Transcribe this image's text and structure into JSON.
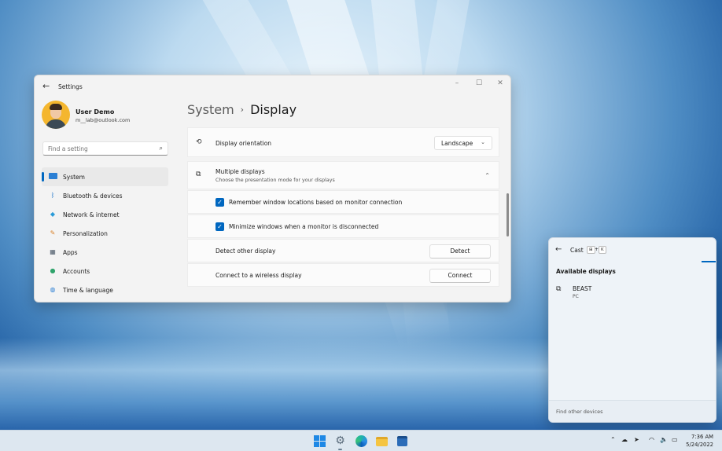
{
  "settings_window": {
    "title": "Settings",
    "profile": {
      "name": "User Demo",
      "email": "m__lab@outlook.com"
    },
    "search": {
      "placeholder": "Find a setting"
    },
    "nav_items": [
      {
        "label": "System",
        "icon": "system-icon",
        "active": true
      },
      {
        "label": "Bluetooth & devices",
        "icon": "bluetooth-icon"
      },
      {
        "label": "Network & internet",
        "icon": "wifi-icon"
      },
      {
        "label": "Personalization",
        "icon": "brush-icon"
      },
      {
        "label": "Apps",
        "icon": "apps-icon"
      },
      {
        "label": "Accounts",
        "icon": "accounts-icon"
      },
      {
        "label": "Time & language",
        "icon": "globe-icon"
      }
    ],
    "breadcrumb": {
      "parent": "System",
      "separator": "›",
      "current": "Display"
    },
    "display_orientation": {
      "label": "Display orientation",
      "value": "Landscape"
    },
    "multiple_displays": {
      "title": "Multiple displays",
      "subtitle": "Choose the presentation mode for your displays",
      "options": [
        {
          "label": "Remember window locations based on monitor connection",
          "checked": true
        },
        {
          "label": "Minimize windows when a monitor is disconnected",
          "checked": true
        }
      ],
      "detect": {
        "label": "Detect other display",
        "button": "Detect"
      },
      "wireless": {
        "label": "Connect to a wireless display",
        "button": "Connect"
      }
    }
  },
  "cast_panel": {
    "title": "Cast",
    "shortcut_keys": [
      "⊞",
      "+",
      "K"
    ],
    "heading": "Available displays",
    "device": {
      "name": "BEAST",
      "type": "PC"
    },
    "footer": "Find other devices"
  },
  "taskbar": {
    "apps": [
      "start-icon",
      "settings-icon",
      "edge-icon",
      "file-explorer-icon",
      "store-icon"
    ],
    "time": "7:36 AM",
    "date": "5/24/2022"
  },
  "colors": {
    "accent": "#0067c0",
    "window_bg": "#f3f3f3",
    "panel_bg": "#fbfbfb"
  }
}
